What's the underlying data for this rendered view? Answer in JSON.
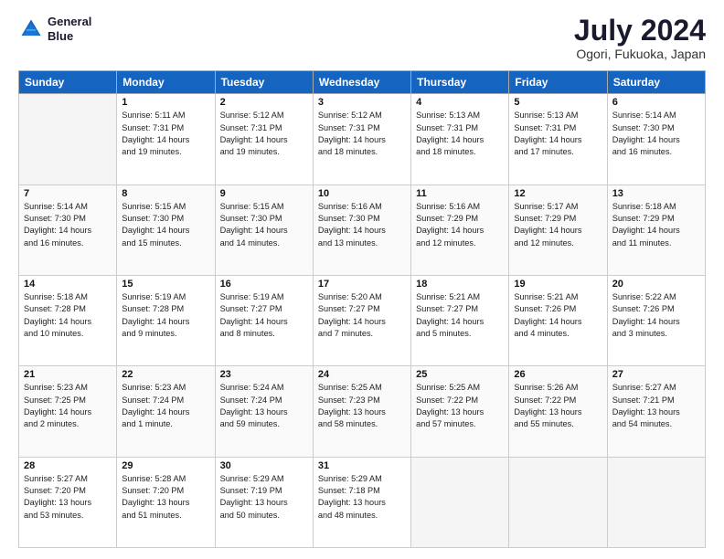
{
  "logo": {
    "line1": "General",
    "line2": "Blue"
  },
  "title": "July 2024",
  "subtitle": "Ogori, Fukuoka, Japan",
  "headers": [
    "Sunday",
    "Monday",
    "Tuesday",
    "Wednesday",
    "Thursday",
    "Friday",
    "Saturday"
  ],
  "weeks": [
    [
      {
        "day": "",
        "info": ""
      },
      {
        "day": "1",
        "info": "Sunrise: 5:11 AM\nSunset: 7:31 PM\nDaylight: 14 hours\nand 19 minutes."
      },
      {
        "day": "2",
        "info": "Sunrise: 5:12 AM\nSunset: 7:31 PM\nDaylight: 14 hours\nand 19 minutes."
      },
      {
        "day": "3",
        "info": "Sunrise: 5:12 AM\nSunset: 7:31 PM\nDaylight: 14 hours\nand 18 minutes."
      },
      {
        "day": "4",
        "info": "Sunrise: 5:13 AM\nSunset: 7:31 PM\nDaylight: 14 hours\nand 18 minutes."
      },
      {
        "day": "5",
        "info": "Sunrise: 5:13 AM\nSunset: 7:31 PM\nDaylight: 14 hours\nand 17 minutes."
      },
      {
        "day": "6",
        "info": "Sunrise: 5:14 AM\nSunset: 7:30 PM\nDaylight: 14 hours\nand 16 minutes."
      }
    ],
    [
      {
        "day": "7",
        "info": "Sunrise: 5:14 AM\nSunset: 7:30 PM\nDaylight: 14 hours\nand 16 minutes."
      },
      {
        "day": "8",
        "info": "Sunrise: 5:15 AM\nSunset: 7:30 PM\nDaylight: 14 hours\nand 15 minutes."
      },
      {
        "day": "9",
        "info": "Sunrise: 5:15 AM\nSunset: 7:30 PM\nDaylight: 14 hours\nand 14 minutes."
      },
      {
        "day": "10",
        "info": "Sunrise: 5:16 AM\nSunset: 7:30 PM\nDaylight: 14 hours\nand 13 minutes."
      },
      {
        "day": "11",
        "info": "Sunrise: 5:16 AM\nSunset: 7:29 PM\nDaylight: 14 hours\nand 12 minutes."
      },
      {
        "day": "12",
        "info": "Sunrise: 5:17 AM\nSunset: 7:29 PM\nDaylight: 14 hours\nand 12 minutes."
      },
      {
        "day": "13",
        "info": "Sunrise: 5:18 AM\nSunset: 7:29 PM\nDaylight: 14 hours\nand 11 minutes."
      }
    ],
    [
      {
        "day": "14",
        "info": "Sunrise: 5:18 AM\nSunset: 7:28 PM\nDaylight: 14 hours\nand 10 minutes."
      },
      {
        "day": "15",
        "info": "Sunrise: 5:19 AM\nSunset: 7:28 PM\nDaylight: 14 hours\nand 9 minutes."
      },
      {
        "day": "16",
        "info": "Sunrise: 5:19 AM\nSunset: 7:27 PM\nDaylight: 14 hours\nand 8 minutes."
      },
      {
        "day": "17",
        "info": "Sunrise: 5:20 AM\nSunset: 7:27 PM\nDaylight: 14 hours\nand 7 minutes."
      },
      {
        "day": "18",
        "info": "Sunrise: 5:21 AM\nSunset: 7:27 PM\nDaylight: 14 hours\nand 5 minutes."
      },
      {
        "day": "19",
        "info": "Sunrise: 5:21 AM\nSunset: 7:26 PM\nDaylight: 14 hours\nand 4 minutes."
      },
      {
        "day": "20",
        "info": "Sunrise: 5:22 AM\nSunset: 7:26 PM\nDaylight: 14 hours\nand 3 minutes."
      }
    ],
    [
      {
        "day": "21",
        "info": "Sunrise: 5:23 AM\nSunset: 7:25 PM\nDaylight: 14 hours\nand 2 minutes."
      },
      {
        "day": "22",
        "info": "Sunrise: 5:23 AM\nSunset: 7:24 PM\nDaylight: 14 hours\nand 1 minute."
      },
      {
        "day": "23",
        "info": "Sunrise: 5:24 AM\nSunset: 7:24 PM\nDaylight: 13 hours\nand 59 minutes."
      },
      {
        "day": "24",
        "info": "Sunrise: 5:25 AM\nSunset: 7:23 PM\nDaylight: 13 hours\nand 58 minutes."
      },
      {
        "day": "25",
        "info": "Sunrise: 5:25 AM\nSunset: 7:22 PM\nDaylight: 13 hours\nand 57 minutes."
      },
      {
        "day": "26",
        "info": "Sunrise: 5:26 AM\nSunset: 7:22 PM\nDaylight: 13 hours\nand 55 minutes."
      },
      {
        "day": "27",
        "info": "Sunrise: 5:27 AM\nSunset: 7:21 PM\nDaylight: 13 hours\nand 54 minutes."
      }
    ],
    [
      {
        "day": "28",
        "info": "Sunrise: 5:27 AM\nSunset: 7:20 PM\nDaylight: 13 hours\nand 53 minutes."
      },
      {
        "day": "29",
        "info": "Sunrise: 5:28 AM\nSunset: 7:20 PM\nDaylight: 13 hours\nand 51 minutes."
      },
      {
        "day": "30",
        "info": "Sunrise: 5:29 AM\nSunset: 7:19 PM\nDaylight: 13 hours\nand 50 minutes."
      },
      {
        "day": "31",
        "info": "Sunrise: 5:29 AM\nSunset: 7:18 PM\nDaylight: 13 hours\nand 48 minutes."
      },
      {
        "day": "",
        "info": ""
      },
      {
        "day": "",
        "info": ""
      },
      {
        "day": "",
        "info": ""
      }
    ]
  ]
}
